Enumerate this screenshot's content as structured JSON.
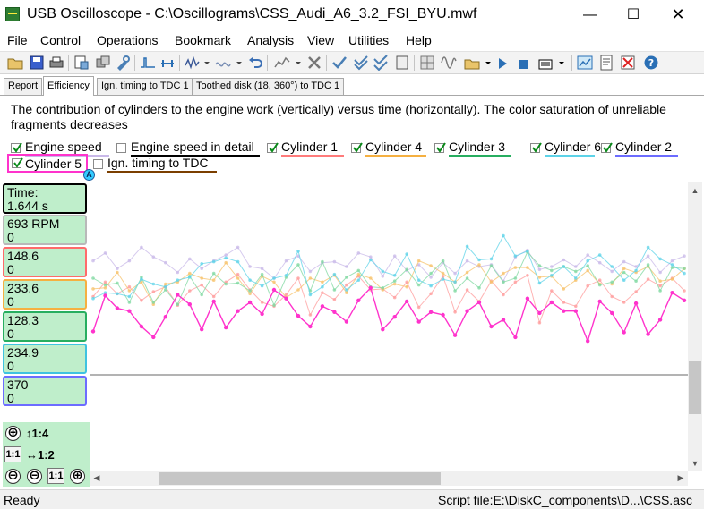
{
  "window": {
    "title": "USB Oscilloscope - C:\\Oscillograms\\CSS_Audi_A6_3.2_FSI_BYU.mwf",
    "minimize": "—",
    "maximize": "☐",
    "close": "✕"
  },
  "menu": [
    "File",
    "Control",
    "Operations",
    "Bookmark",
    "Analysis",
    "View",
    "Utilities",
    "Help"
  ],
  "tabs": [
    "Report",
    "Efficiency",
    "Ign. timing to TDC 1",
    "Toothed disk (18, 360°) to TDC 1"
  ],
  "active_tab": "Efficiency",
  "description": "The contribution of cylinders to the engine work (vertically) versus time (horizontally). The color saturation of unreliable fragments decreases",
  "legend": [
    {
      "label": "Engine speed",
      "checked": true,
      "color": "#c8b8e8"
    },
    {
      "label": "Engine speed in detail",
      "checked": false,
      "color": "#000000"
    },
    {
      "label": "Cylinder 1",
      "checked": true,
      "color": "#ff7b7b"
    },
    {
      "label": "Cylinder 4",
      "checked": true,
      "color": "#f5b041"
    },
    {
      "label": "Cylinder 3",
      "checked": true,
      "color": "#27ae60"
    },
    {
      "label": "Cylinder 6",
      "checked": true,
      "color": "#5dd3e8"
    },
    {
      "label": "Cylinder 2",
      "checked": true,
      "color": "#6c6cff"
    },
    {
      "label": "Cylinder 5",
      "checked": true,
      "color": "#ff33cc"
    },
    {
      "label": "Ign. timing to TDC",
      "checked": false,
      "color": "#7b3f00"
    }
  ],
  "marker_label": "A",
  "values": {
    "time_label": "Time:",
    "time_value": "1.644 s",
    "rpm_label": "693 RPM",
    "rpm_value": "0",
    "cyl1_value": "148.6",
    "cyl1_sub": "0",
    "cyl4_value": "233.6",
    "cyl4_sub": "0",
    "cyl3_value": "128.3",
    "cyl3_sub": "0",
    "cyl6_value": "234.9",
    "cyl6_sub": "0",
    "cyl2_value": "370",
    "cyl2_sub": "0"
  },
  "value_box_colors": [
    "#000000",
    "#b9b9b9",
    "#ff6b6b",
    "#f5b041",
    "#27ae60",
    "#3fc3e0",
    "#6c6cff"
  ],
  "scale": {
    "v_scale": "1:4",
    "h_scale": "1:2",
    "zoom_in": "⊕",
    "zoom_out": "⊖",
    "one_to_one": "1:1"
  },
  "status": {
    "left": "Ready",
    "right": "Script file:E:\\DiskC_components\\D...\\CSS.asc"
  },
  "chart_data": {
    "type": "line",
    "x": [
      1,
      2,
      3,
      4,
      5,
      6,
      7,
      8,
      9,
      10,
      11,
      12,
      13,
      14,
      15,
      16,
      17,
      18,
      19,
      20,
      21,
      22,
      23,
      24,
      25,
      26,
      27,
      28,
      29,
      30,
      31,
      32,
      33,
      34,
      35,
      36,
      37,
      38,
      39,
      40,
      41,
      42,
      43,
      44,
      45,
      46,
      47,
      48,
      49,
      50
    ],
    "ylim": [
      0,
      300
    ],
    "series": [
      {
        "name": "Engine speed",
        "color": "#c8b8e8",
        "values": [
          218,
          226,
          210,
          218,
          232,
          222,
          216,
          206,
          220,
          210,
          218,
          224,
          232,
          212,
          210,
          200,
          218,
          223,
          207,
          216,
          217,
          212,
          226,
          222,
          202,
          223,
          208,
          214,
          201,
          216,
          205,
          218,
          212,
          214,
          197,
          222,
          229,
          209,
          212,
          219,
          212,
          224,
          216,
          207,
          217,
          212,
          223,
          206,
          218,
          223
        ]
      },
      {
        "name": "Cylinder 1",
        "color": "#ff9b9b",
        "values": [
          181,
          196,
          184,
          191,
          177,
          186,
          191,
          172,
          187,
          193,
          181,
          196,
          204,
          188,
          175,
          171,
          183,
          200,
          162,
          185,
          178,
          193,
          202,
          188,
          189,
          180,
          196,
          170,
          184,
          202,
          165,
          188,
          176,
          197,
          183,
          196,
          203,
          154,
          187,
          175,
          171,
          192,
          198,
          181,
          175,
          186,
          199,
          192,
          200,
          187
        ]
      },
      {
        "name": "Cylinder 4",
        "color": "#f7c16a",
        "values": [
          189,
          190,
          206,
          187,
          196,
          173,
          194,
          196,
          205,
          200,
          198,
          216,
          200,
          184,
          202,
          196,
          180,
          188,
          200,
          196,
          203,
          185,
          204,
          200,
          188,
          194,
          191,
          218,
          213,
          205,
          196,
          206,
          214,
          196,
          205,
          211,
          211,
          201,
          202,
          189,
          198,
          208,
          194,
          194,
          210,
          206,
          212,
          197,
          199,
          210
        ]
      },
      {
        "name": "Cylinder 3",
        "color": "#7fd8a0",
        "values": [
          200,
          193,
          195,
          175,
          201,
          175,
          188,
          173,
          202,
          183,
          205,
          194,
          195,
          187,
          204,
          172,
          201,
          214,
          187,
          217,
          188,
          201,
          208,
          191,
          190,
          197,
          209,
          193,
          205,
          218,
          187,
          200,
          190,
          213,
          196,
          200,
          227,
          213,
          208,
          212,
          207,
          213,
          193,
          196,
          206,
          197,
          214,
          187,
          211,
          210
        ]
      },
      {
        "name": "Cylinder 6",
        "color": "#5dd3e8",
        "values": [
          179,
          185,
          184,
          181,
          199,
          194,
          191,
          198,
          201,
          215,
          217,
          221,
          217,
          198,
          192,
          200,
          203,
          228,
          183,
          191,
          204,
          188,
          198,
          219,
          207,
          203,
          225,
          198,
          192,
          199,
          196,
          233,
          219,
          220,
          244,
          223,
          228,
          195,
          203,
          212,
          200,
          218,
          224,
          212,
          198,
          208,
          232,
          220,
          214,
          205
        ]
      },
      {
        "name": "Cylinder 5",
        "color": "#ff33cc",
        "values": [
          145,
          182,
          169,
          166,
          150,
          139,
          160,
          183,
          173,
          147,
          176,
          149,
          166,
          175,
          163,
          188,
          179,
          161,
          150,
          171,
          165,
          155,
          177,
          190,
          147,
          160,
          176,
          155,
          165,
          162,
          141,
          166,
          175,
          150,
          157,
          139,
          179,
          164,
          175,
          166,
          166,
          135,
          176,
          164,
          144,
          174,
          142,
          157,
          185,
          177
        ]
      }
    ],
    "baseline": 100
  }
}
